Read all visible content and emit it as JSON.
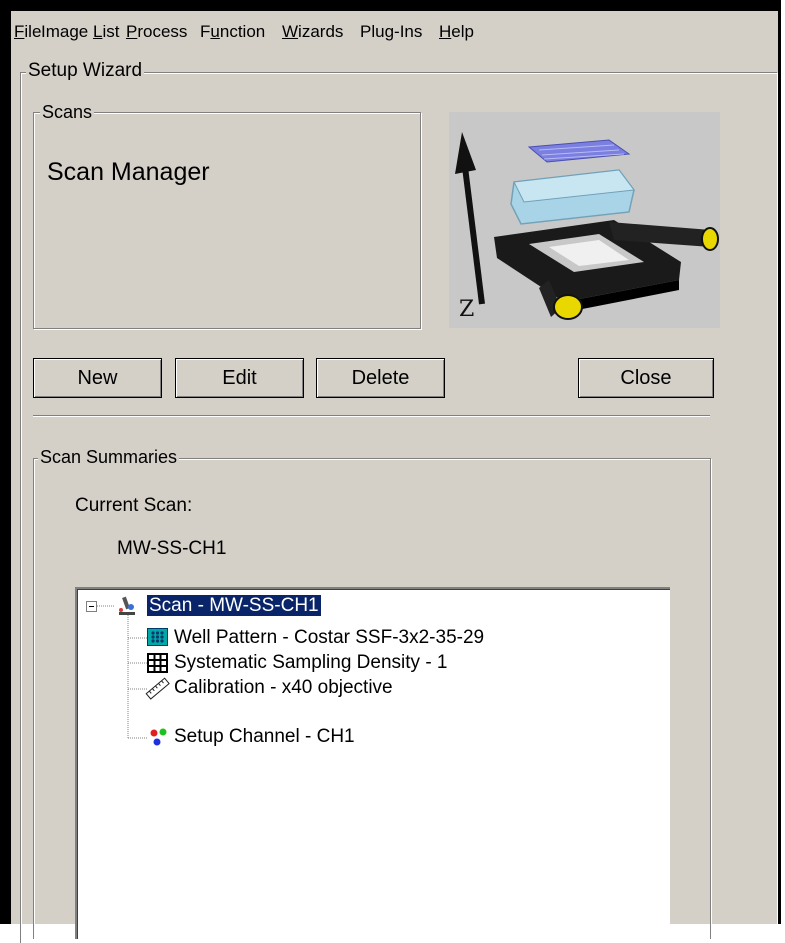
{
  "menu": [
    {
      "mnemonic": "F",
      "rest": "ile"
    },
    {
      "pre": "Image ",
      "mnemonic": "L",
      "rest": "ist"
    },
    {
      "mnemonic": "P",
      "rest": "rocess"
    },
    {
      "pre": "F",
      "mnemonic": "u",
      "rest": "nction"
    },
    {
      "mnemonic": "W",
      "rest": "izards"
    },
    {
      "pre": "Plu",
      "mnemonic": "g",
      "rest": "-Ins"
    },
    {
      "mnemonic": "H",
      "rest": "elp"
    }
  ],
  "setup_wizard": {
    "legend": "Setup Wizard",
    "scans": {
      "legend": "Scans",
      "title": "Scan Manager"
    },
    "preview": {
      "axis_label": "Z",
      "icon": "microscope-stage-illustration"
    },
    "buttons": {
      "new": "New",
      "edit": "Edit",
      "delete": "Delete",
      "close": "Close"
    },
    "summaries": {
      "legend": "Scan Summaries",
      "current_scan_label": "Current Scan:",
      "current_scan_value": "MW-SS-CH1",
      "tree": {
        "root": {
          "label": "Scan - MW-SS-CH1",
          "icon": "microscope-icon",
          "expander": "minus"
        },
        "children": [
          {
            "label": "Well Pattern - Costar SSF-3x2-35-29",
            "icon": "well-pattern-icon"
          },
          {
            "label": "Systematic Sampling Density - 1",
            "icon": "grid-icon"
          },
          {
            "label": "Calibration - x40 objective",
            "icon": "ruler-icon"
          },
          {
            "label": "Setup Channel - CH1",
            "icon": "color-channels-icon"
          }
        ]
      }
    }
  },
  "colors": {
    "background": "#d4d0c8",
    "selection": "#0a246a",
    "stage_accent": "#e8d800"
  }
}
